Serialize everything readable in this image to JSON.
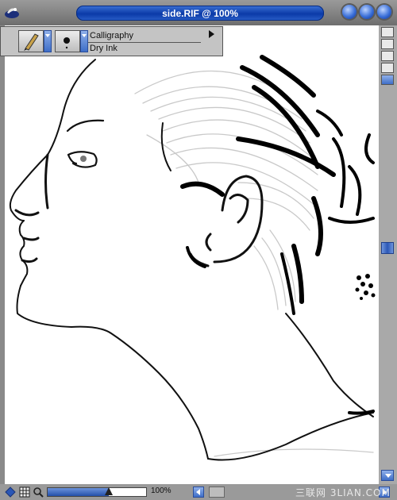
{
  "window": {
    "title": "side.RIF @ 100%"
  },
  "property_bar": {
    "brush_category": "Calligraphy",
    "brush_variant": "Dry Ink",
    "brush_icon": "calligraphy-pen-icon",
    "dab_icon": "dab-dot-icon"
  },
  "status_bar": {
    "zoom_text": "100%",
    "zoom_level": 0.62
  },
  "watermark": {
    "text": "三联网 3LIAN.COM"
  },
  "colors": {
    "title_accent": "#0b3aa8",
    "scroll_accent": "#3e6ec8",
    "canvas": "#ffffff"
  }
}
